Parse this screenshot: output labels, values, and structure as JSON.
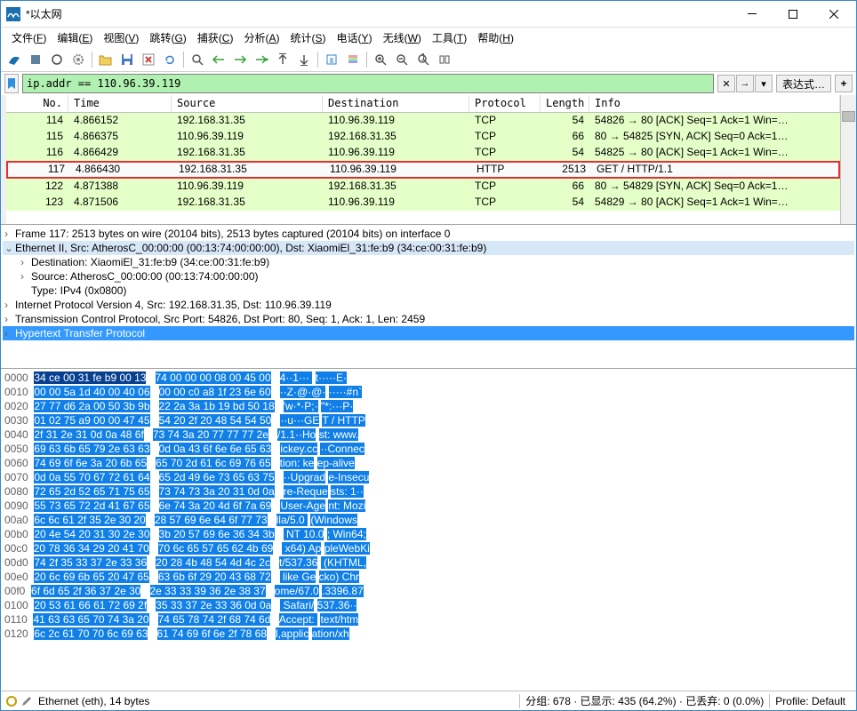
{
  "title": "*以太网",
  "menu": [
    "文件(F)",
    "编辑(E)",
    "视图(V)",
    "跳转(G)",
    "捕获(C)",
    "分析(A)",
    "统计(S)",
    "电话(Y)",
    "无线(W)",
    "工具(T)",
    "帮助(H)"
  ],
  "filter": "ip.addr == 110.96.39.119",
  "expr_label": "表达式…",
  "columns": {
    "no": "No.",
    "time": "Time",
    "src": "Source",
    "dst": "Destination",
    "proto": "Protocol",
    "len": "Length",
    "info": "Info"
  },
  "packets": [
    {
      "no": "114",
      "time": "4.866152",
      "src": "192.168.31.35",
      "dst": "110.96.39.119",
      "proto": "TCP",
      "len": "54",
      "info": "54826 → 80 [ACK] Seq=1 Ack=1 Win=…",
      "cls": "green"
    },
    {
      "no": "115",
      "time": "4.866375",
      "src": "110.96.39.119",
      "dst": "192.168.31.35",
      "proto": "TCP",
      "len": "66",
      "info": "80 → 54825 [SYN, ACK] Seq=0 Ack=1…",
      "cls": "green"
    },
    {
      "no": "116",
      "time": "4.866429",
      "src": "192.168.31.35",
      "dst": "110.96.39.119",
      "proto": "TCP",
      "len": "54",
      "info": "54825 → 80 [ACK] Seq=1 Ack=1 Win=…",
      "cls": "green"
    },
    {
      "no": "117",
      "time": "4.866430",
      "src": "192.168.31.35",
      "dst": "110.96.39.119",
      "proto": "HTTP",
      "len": "2513",
      "info": "GET / HTTP/1.1 ",
      "cls": "selected"
    },
    {
      "no": "122",
      "time": "4.871388",
      "src": "110.96.39.119",
      "dst": "192.168.31.35",
      "proto": "TCP",
      "len": "66",
      "info": "80 → 54829 [SYN, ACK] Seq=0 Ack=1…",
      "cls": "green"
    },
    {
      "no": "123",
      "time": "4.871506",
      "src": "192.168.31.35",
      "dst": "110.96.39.119",
      "proto": "TCP",
      "len": "54",
      "info": "54829 → 80 [ACK] Seq=1 Ack=1 Win=…",
      "cls": "green"
    }
  ],
  "details": [
    {
      "t": "Frame 117: 2513 bytes on wire (20104 bits), 2513 bytes captured (20104 bits) on interface 0",
      "ind": 0,
      "arr": ">",
      "sel": ""
    },
    {
      "t": "Ethernet II, Src: AtherosC_00:00:00 (00:13:74:00:00:00), Dst: XiaomiEl_31:fe:b9 (34:ce:00:31:fe:b9)",
      "ind": 0,
      "arr": "v",
      "sel": "sel1"
    },
    {
      "t": "Destination: XiaomiEl_31:fe:b9 (34:ce:00:31:fe:b9)",
      "ind": 1,
      "arr": ">",
      "sel": ""
    },
    {
      "t": "Source: AtherosC_00:00:00 (00:13:74:00:00:00)",
      "ind": 1,
      "arr": ">",
      "sel": ""
    },
    {
      "t": "Type: IPv4 (0x0800)",
      "ind": 1,
      "arr": "",
      "sel": ""
    },
    {
      "t": "Internet Protocol Version 4, Src: 192.168.31.35, Dst: 110.96.39.119",
      "ind": 0,
      "arr": ">",
      "sel": ""
    },
    {
      "t": "Transmission Control Protocol, Src Port: 54826, Dst Port: 80, Seq: 1, Ack: 1, Len: 2459",
      "ind": 0,
      "arr": ">",
      "sel": ""
    },
    {
      "t": "Hypertext Transfer Protocol",
      "ind": 0,
      "arr": ">",
      "sel": "sel2"
    }
  ],
  "hex": [
    {
      "o": "0000",
      "h1": "34 ce 00 31 fe b9 00 13",
      "h2": "74 00 00 00 08 00 45 00",
      "a1": "4··1··· ",
      "a2": "t·····E·"
    },
    {
      "o": "0010",
      "h1": "00 00 5a 1d 40 00 40 06",
      "h2": "00 00 c0 a8 1f 23 6e 60",
      "a1": "··Z·@·@·",
      "a2": "·····#n`"
    },
    {
      "o": "0020",
      "h1": "27 77 d6 2a 00 50 3b 9b",
      "h2": "22 2a 3a 1b 19 bd 50 18",
      "a1": "'w·*·P;·",
      "a2": "\"*:···P·"
    },
    {
      "o": "0030",
      "h1": "01 02 75 a9 00 00 47 45",
      "h2": "54 20 2f 20 48 54 54 50",
      "a1": "··u···GE",
      "a2": "T / HTTP"
    },
    {
      "o": "0040",
      "h1": "2f 31 2e 31 0d 0a 48 6f",
      "h2": "73 74 3a 20 77 77 77 2e",
      "a1": "/1.1··Ho",
      "a2": "st: www."
    },
    {
      "o": "0050",
      "h1": "69 63 6b 65 79 2e 63 63",
      "h2": "0d 0a 43 6f 6e 6e 65 63",
      "a1": "ickey.cc",
      "a2": "··Connec"
    },
    {
      "o": "0060",
      "h1": "74 69 6f 6e 3a 20 6b 65",
      "h2": "65 70 2d 61 6c 69 76 65",
      "a1": "tion: ke",
      "a2": "ep-alive"
    },
    {
      "o": "0070",
      "h1": "0d 0a 55 70 67 72 61 64",
      "h2": "65 2d 49 6e 73 65 63 75",
      "a1": "··Upgrad",
      "a2": "e-Insecu"
    },
    {
      "o": "0080",
      "h1": "72 65 2d 52 65 71 75 65",
      "h2": "73 74 73 3a 20 31 0d 0a",
      "a1": "re-Reque",
      "a2": "sts: 1··"
    },
    {
      "o": "0090",
      "h1": "55 73 65 72 2d 41 67 65",
      "h2": "6e 74 3a 20 4d 6f 7a 69",
      "a1": "User-Age",
      "a2": "nt: Mozi"
    },
    {
      "o": "00a0",
      "h1": "6c 6c 61 2f 35 2e 30 20",
      "h2": "28 57 69 6e 64 6f 77 73",
      "a1": "lla/5.0 ",
      "a2": "(Windows"
    },
    {
      "o": "00b0",
      "h1": "20 4e 54 20 31 30 2e 30",
      "h2": "3b 20 57 69 6e 36 34 3b",
      "a1": " NT 10.0",
      "a2": "; Win64;"
    },
    {
      "o": "00c0",
      "h1": "20 78 36 34 29 20 41 70",
      "h2": "70 6c 65 57 65 62 4b 69",
      "a1": " x64) Ap",
      "a2": "pleWebKi"
    },
    {
      "o": "00d0",
      "h1": "74 2f 35 33 37 2e 33 36",
      "h2": "20 28 4b 48 54 4d 4c 2c",
      "a1": "t/537.36",
      "a2": " (KHTML,"
    },
    {
      "o": "00e0",
      "h1": "20 6c 69 6b 65 20 47 65",
      "h2": "63 6b 6f 29 20 43 68 72",
      "a1": " like Ge",
      "a2": "cko) Chr"
    },
    {
      "o": "00f0",
      "h1": "6f 6d 65 2f 36 37 2e 30",
      "h2": "2e 33 33 39 36 2e 38 37",
      "a1": "ome/67.0",
      "a2": ".3396.87"
    },
    {
      "o": "0100",
      "h1": "20 53 61 66 61 72 69 2f",
      "h2": "35 33 37 2e 33 36 0d 0a",
      "a1": " Safari/",
      "a2": "537.36··"
    },
    {
      "o": "0110",
      "h1": "41 63 63 65 70 74 3a 20",
      "h2": "74 65 78 74 2f 68 74 6d",
      "a1": "Accept: ",
      "a2": "text/htm"
    },
    {
      "o": "0120",
      "h1": "6c 2c 61 70 70 6c 69 63",
      "h2": "61 74 69 6f 6e 2f 78 68",
      "a1": "l,applic",
      "a2": "ation/xh"
    }
  ],
  "status": {
    "frame": "Ethernet (eth), 14 bytes",
    "pkts": "分组: 678 · 已显示: 435 (64.2%) · 已丢弃: 0 (0.0%)",
    "profile": "Profile: Default"
  }
}
